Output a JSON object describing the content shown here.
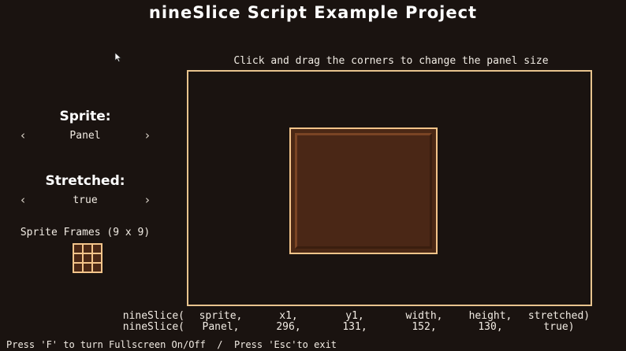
{
  "title": "nineSlice Script Example Project",
  "instructions": "Click and drag the corners to change the panel size",
  "sprite": {
    "label": "Sprite:",
    "value": "Panel",
    "prev_icon": "chevron-left-icon",
    "next_icon": "chevron-right-icon"
  },
  "stretched": {
    "label": "Stretched:",
    "value": "true",
    "prev_icon": "chevron-left-icon",
    "next_icon": "chevron-right-icon"
  },
  "frames": {
    "label": "Sprite Frames (9 x 9)",
    "icon": "nine-slice-frames-icon"
  },
  "code": {
    "fn_line1": "nineSlice(",
    "fn_line2": "nineSlice(",
    "columns": [
      {
        "line1": "sprite,",
        "line2": "Panel,"
      },
      {
        "line1": "x1,",
        "line2": "296,"
      },
      {
        "line1": "y1,",
        "line2": "131,"
      },
      {
        "line1": "width,",
        "line2": "152,"
      },
      {
        "line1": "height,",
        "line2": "130,"
      },
      {
        "line1": "stretched)",
        "line2": "true)"
      }
    ]
  },
  "footer": "Press 'F' to turn Fullscreen On/Off  /  Press 'Esc'to exit",
  "colors": {
    "background": "#1a1310",
    "border": "#e8c48e",
    "panel_fill": "#4b2815",
    "panel_border": "#f3c48a"
  }
}
